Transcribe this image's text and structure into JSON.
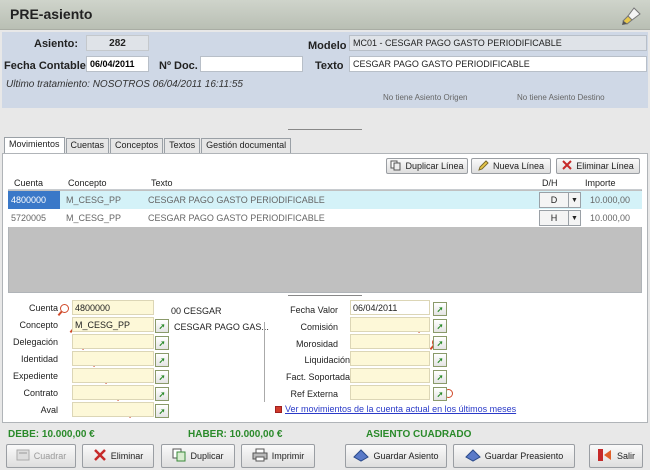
{
  "window": {
    "title": "PRE-asiento"
  },
  "header": {
    "asiento_label": "Asiento:",
    "asiento_value": "282",
    "modelo_label": "Modelo",
    "modelo_value": "MC01 - CESGAR PAGO GASTO PERIODIFICABLE",
    "fecha_label": "Fecha Contable:",
    "fecha_value": "06/04/2011",
    "ndoc_label": "Nº Doc.",
    "ndoc_value": "",
    "texto_label": "Texto",
    "texto_value": "CESGAR PAGO GASTO PERIODIFICABLE",
    "ultimo": "Ultimo tratamiento: NOSOTROS 06/04/2011 16:11:55",
    "origen": "No tiene Asiento Origen",
    "destino": "No tiene Asiento Destino"
  },
  "tabs": [
    "Movimientos",
    "Cuentas",
    "Conceptos",
    "Textos",
    "Gestión documental"
  ],
  "toolbar": {
    "duplicar": "Duplicar Línea",
    "nueva": "Nueva Línea",
    "eliminar": "Eliminar Línea"
  },
  "table": {
    "columns": [
      "Cuenta",
      "Concepto",
      "Texto",
      "D/H",
      "Importe"
    ],
    "rows": [
      {
        "cuenta": "4800000",
        "concepto": "M_CESG_PP",
        "texto": "CESGAR PAGO GASTO PERIODIFICABLE",
        "dh": "D",
        "importe": "10.000,00"
      },
      {
        "cuenta": "5720005",
        "concepto": "M_CESG_PP",
        "texto": "CESGAR PAGO GASTO PERIODIFICABLE",
        "dh": "H",
        "importe": "10.000,00"
      }
    ]
  },
  "form": {
    "left": [
      {
        "label": "Cuenta",
        "value": "4800000"
      },
      {
        "label": "Concepto",
        "value": "M_CESG_PP"
      },
      {
        "label": "Delegación",
        "value": ""
      },
      {
        "label": "Identidad",
        "value": ""
      },
      {
        "label": "Expediente",
        "value": ""
      },
      {
        "label": "Contrato",
        "value": ""
      },
      {
        "label": "Aval",
        "value": ""
      }
    ],
    "cuenta_desc": "00 CESGAR",
    "concepto_desc": "CESGAR PAGO GAS...",
    "right": [
      {
        "label": "Fecha Valor",
        "value": "06/04/2011"
      },
      {
        "label": "Comisión",
        "value": ""
      },
      {
        "label": "Morosidad",
        "value": ""
      },
      {
        "label": "Liquidación",
        "value": ""
      },
      {
        "label": "Fact. Soportada",
        "value": ""
      },
      {
        "label": "Ref Externa",
        "value": ""
      }
    ],
    "link": "Ver movimientos de la cuenta actual en los últimos meses"
  },
  "totals": {
    "debe": "DEBE: 10.000,00 €",
    "haber": "HABER: 10.000,00 €",
    "status": "ASIENTO CUADRADO"
  },
  "buttons": {
    "cuadrar": "Cuadrar",
    "eliminar": "Eliminar",
    "duplicar": "Duplicar",
    "imprimir": "Imprimir",
    "guardar_asiento": "Guardar Asiento",
    "guardar_preasiento": "Guardar Preasiento",
    "salir": "Salir"
  },
  "colors": {
    "panel": "#cfd8e6",
    "selected_row": "#d4f2f8",
    "field_yellow": "#fdf8d8",
    "green_text": "#2a8a2a"
  }
}
